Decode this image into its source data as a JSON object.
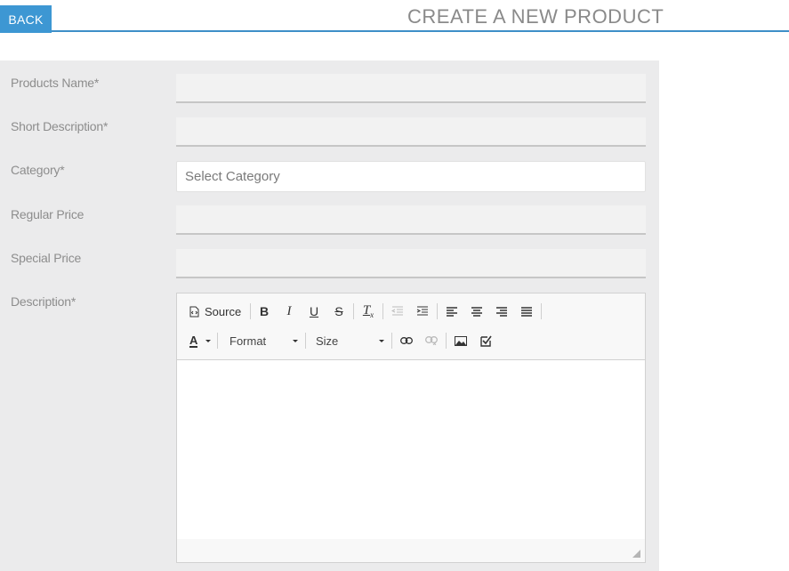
{
  "header": {
    "back_label": "BACK",
    "title": "CREATE A NEW PRODUCT",
    "accent_color": "#3d97d3"
  },
  "form": {
    "product_name_label": "Products Name*",
    "product_name_value": "",
    "short_description_label": "Short Description*",
    "short_description_value": "",
    "category_label": "Category*",
    "category_placeholder": "Select Category",
    "regular_price_label": "Regular Price",
    "regular_price_value": "",
    "special_price_label": "Special Price",
    "special_price_value": "",
    "description_label": "Description*"
  },
  "editor": {
    "source_label": "Source",
    "format_label": "Format",
    "size_label": "Size",
    "icons": [
      "source-icon",
      "bold-icon",
      "italic-icon",
      "underline-icon",
      "strikethrough-icon",
      "remove-format-icon",
      "outdent-icon",
      "indent-icon",
      "align-left-icon",
      "align-center-icon",
      "align-right-icon",
      "justify-icon",
      "text-color-icon",
      "link-icon",
      "unlink-icon",
      "image-icon",
      "checkbox-icon"
    ]
  }
}
